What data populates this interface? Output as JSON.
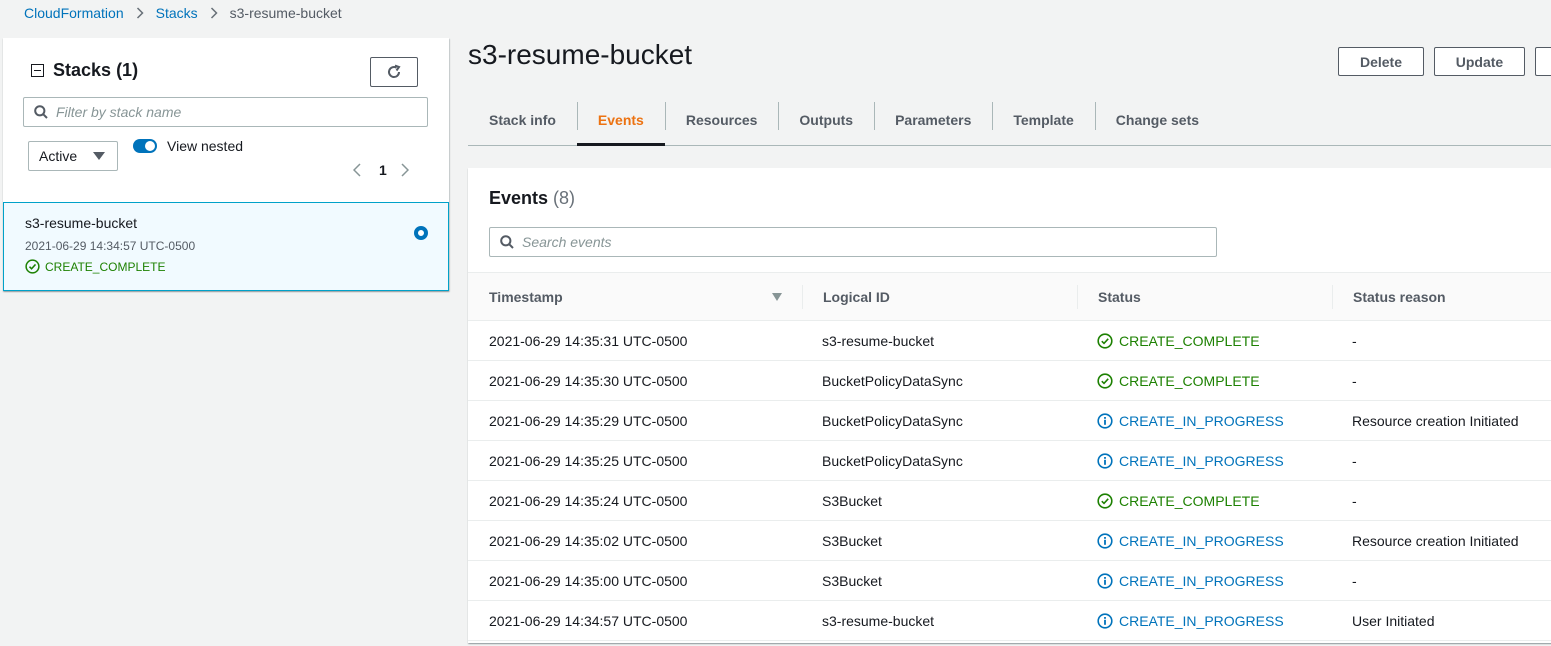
{
  "breadcrumb": {
    "items": [
      "CloudFormation",
      "Stacks"
    ],
    "current": "s3-resume-bucket"
  },
  "stacks_panel": {
    "title": "Stacks",
    "count": "(1)",
    "filter_placeholder": "Filter by stack name",
    "status_filter": "Active",
    "view_nested_label": "View nested",
    "view_nested_on": true,
    "page": "1",
    "stack": {
      "name": "s3-resume-bucket",
      "time": "2021-06-29 14:34:57 UTC-0500",
      "status": "CREATE_COMPLETE",
      "selected": true
    }
  },
  "stack_detail": {
    "title": "s3-resume-bucket",
    "buttons": {
      "delete": "Delete",
      "update": "Update"
    },
    "tabs": [
      {
        "label": "Stack info",
        "active": false
      },
      {
        "label": "Events",
        "active": true
      },
      {
        "label": "Resources",
        "active": false
      },
      {
        "label": "Outputs",
        "active": false
      },
      {
        "label": "Parameters",
        "active": false
      },
      {
        "label": "Template",
        "active": false
      },
      {
        "label": "Change sets",
        "active": false
      }
    ]
  },
  "events": {
    "title": "Events",
    "count": "(8)",
    "search_placeholder": "Search events",
    "columns": {
      "timestamp": "Timestamp",
      "logical_id": "Logical ID",
      "status": "Status",
      "reason": "Status reason"
    },
    "rows": [
      {
        "timestamp": "2021-06-29 14:35:31 UTC-0500",
        "logical_id": "s3-resume-bucket",
        "status": "CREATE_COMPLETE",
        "status_type": "ok",
        "reason": "-"
      },
      {
        "timestamp": "2021-06-29 14:35:30 UTC-0500",
        "logical_id": "BucketPolicyDataSync",
        "status": "CREATE_COMPLETE",
        "status_type": "ok",
        "reason": "-"
      },
      {
        "timestamp": "2021-06-29 14:35:29 UTC-0500",
        "logical_id": "BucketPolicyDataSync",
        "status": "CREATE_IN_PROGRESS",
        "status_type": "progress",
        "reason": "Resource creation Initiated"
      },
      {
        "timestamp": "2021-06-29 14:35:25 UTC-0500",
        "logical_id": "BucketPolicyDataSync",
        "status": "CREATE_IN_PROGRESS",
        "status_type": "progress",
        "reason": "-"
      },
      {
        "timestamp": "2021-06-29 14:35:24 UTC-0500",
        "logical_id": "S3Bucket",
        "status": "CREATE_COMPLETE",
        "status_type": "ok",
        "reason": "-"
      },
      {
        "timestamp": "2021-06-29 14:35:02 UTC-0500",
        "logical_id": "S3Bucket",
        "status": "CREATE_IN_PROGRESS",
        "status_type": "progress",
        "reason": "Resource creation Initiated"
      },
      {
        "timestamp": "2021-06-29 14:35:00 UTC-0500",
        "logical_id": "S3Bucket",
        "status": "CREATE_IN_PROGRESS",
        "status_type": "progress",
        "reason": "-"
      },
      {
        "timestamp": "2021-06-29 14:34:57 UTC-0500",
        "logical_id": "s3-resume-bucket",
        "status": "CREATE_IN_PROGRESS",
        "status_type": "progress",
        "reason": "User Initiated"
      }
    ]
  },
  "colors": {
    "link": "#0073bb",
    "success": "#1d8102",
    "active_tab": "#ec7211",
    "selected_bg": "#f1faff"
  }
}
